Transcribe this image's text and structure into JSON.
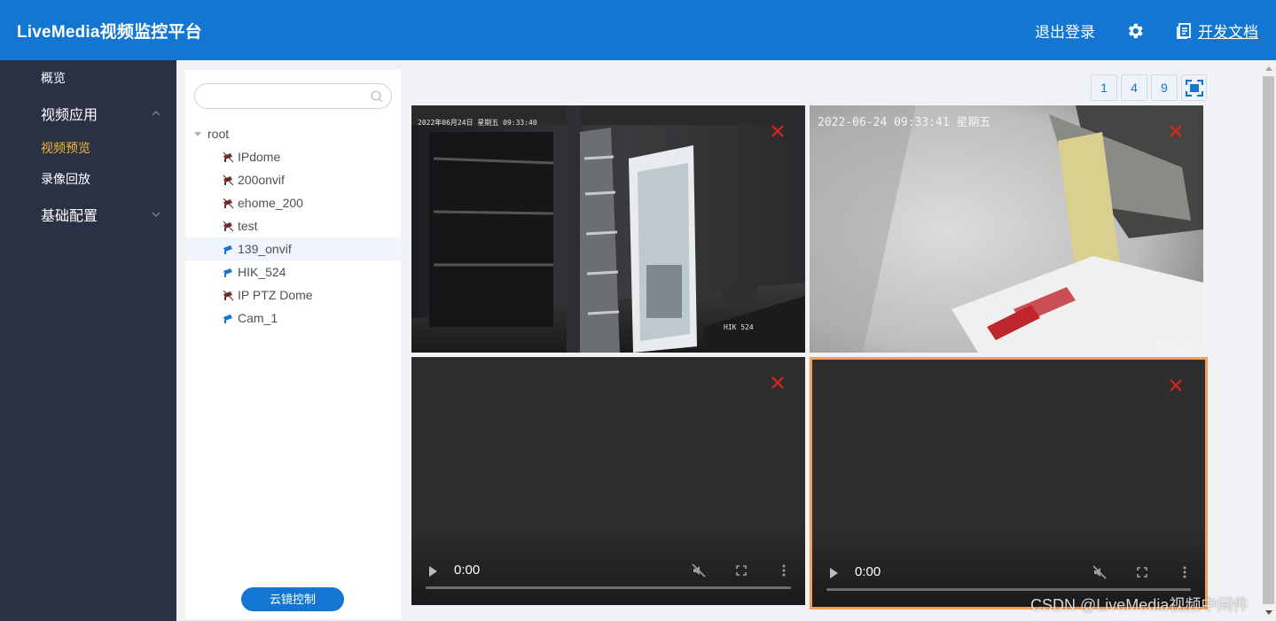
{
  "header": {
    "brand": "LiveMedia视频监控平台",
    "logout": "退出登录",
    "docs": "开发文档",
    "bg_color": "#1276d2"
  },
  "sidebar": {
    "items": [
      {
        "label": "概览"
      },
      {
        "label": "视频应用",
        "expanded": true
      },
      {
        "label": "视频预览",
        "active": true
      },
      {
        "label": "录像回放"
      },
      {
        "label": "基础配置",
        "expanded": false
      }
    ],
    "active_color": "#f3b83c"
  },
  "tree": {
    "search_placeholder": "",
    "root_label": "root",
    "nodes": [
      {
        "label": "IPdome",
        "online": false
      },
      {
        "label": "200onvif",
        "online": false
      },
      {
        "label": "ehome_200",
        "online": false
      },
      {
        "label": "test",
        "online": false
      },
      {
        "label": "139_onvif",
        "online": true,
        "selected": true
      },
      {
        "label": "HIK_524",
        "online": true
      },
      {
        "label": "IP PTZ Dome",
        "online": false
      },
      {
        "label": "Cam_1",
        "online": true
      }
    ],
    "ptz_button": "云镜控制"
  },
  "layout_buttons": [
    "1",
    "4",
    "9"
  ],
  "tiles": [
    {
      "osd_time": "2022年06月24日  星期五  09:33:40",
      "osd_name": "HIK 524",
      "has_video": true
    },
    {
      "osd_time": "2022-06-24 09:33:41 星期五",
      "osd_name": "Cam_1",
      "has_video": true
    },
    {
      "time": "0:00",
      "has_video": false
    },
    {
      "time": "0:00",
      "has_video": false,
      "focused": true
    }
  ],
  "watermark": "CSDN @LiveMedia视频中间件"
}
